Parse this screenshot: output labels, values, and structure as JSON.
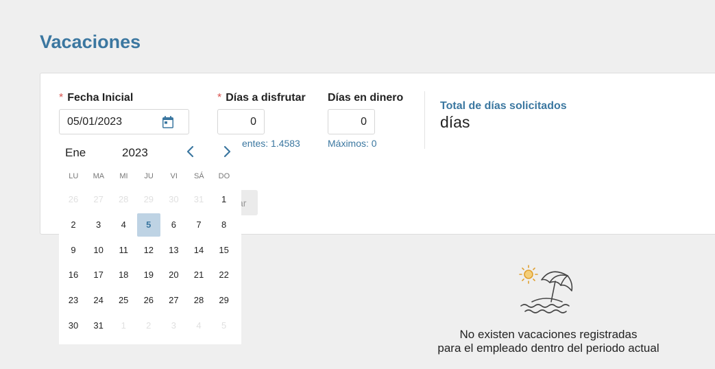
{
  "page": {
    "title": "Vacaciones"
  },
  "form": {
    "fecha_inicial": {
      "required_mark": "*",
      "label": "Fecha Inicial",
      "value": "05/01/2023",
      "icon": "calendar-icon"
    },
    "dias_disfrutar": {
      "required_mark": "*",
      "label": "Días a disfrutar",
      "value": "0",
      "hint": "entes: 1.4583"
    },
    "dias_dinero": {
      "label": "Días en dinero",
      "value": "0",
      "hint": "Máximos: 0"
    },
    "total": {
      "label": "Total de días solicitados",
      "value": "días"
    },
    "partial_button": "ar"
  },
  "calendar": {
    "month": "Ene",
    "year": "2023",
    "weekdays": [
      "LU",
      "MA",
      "MI",
      "JU",
      "VI",
      "SÁ",
      "DO"
    ],
    "weeks": [
      [
        {
          "d": "26",
          "m": true
        },
        {
          "d": "27",
          "m": true
        },
        {
          "d": "28",
          "m": true
        },
        {
          "d": "29",
          "m": true
        },
        {
          "d": "30",
          "m": true
        },
        {
          "d": "31",
          "m": true
        },
        {
          "d": "1"
        }
      ],
      [
        {
          "d": "2"
        },
        {
          "d": "3"
        },
        {
          "d": "4"
        },
        {
          "d": "5",
          "s": true
        },
        {
          "d": "6"
        },
        {
          "d": "7"
        },
        {
          "d": "8"
        }
      ],
      [
        {
          "d": "9"
        },
        {
          "d": "10"
        },
        {
          "d": "11"
        },
        {
          "d": "12"
        },
        {
          "d": "13"
        },
        {
          "d": "14"
        },
        {
          "d": "15"
        }
      ],
      [
        {
          "d": "16"
        },
        {
          "d": "17"
        },
        {
          "d": "18"
        },
        {
          "d": "19"
        },
        {
          "d": "20"
        },
        {
          "d": "21"
        },
        {
          "d": "22"
        }
      ],
      [
        {
          "d": "23"
        },
        {
          "d": "24"
        },
        {
          "d": "25"
        },
        {
          "d": "26"
        },
        {
          "d": "27"
        },
        {
          "d": "28"
        },
        {
          "d": "29"
        }
      ],
      [
        {
          "d": "30"
        },
        {
          "d": "31"
        },
        {
          "d": "1",
          "m": true
        },
        {
          "d": "2",
          "m": true
        },
        {
          "d": "3",
          "m": true
        },
        {
          "d": "4",
          "m": true
        },
        {
          "d": "5",
          "m": true
        }
      ]
    ]
  },
  "empty_state": {
    "icon": "beach-umbrella-icon",
    "line1": "No existen vacaciones registradas",
    "line2": "para el empleado dentro del periodo actual"
  },
  "colors": {
    "accent": "#3b77a0",
    "required": "#d9534f",
    "selected_bg": "#bed3e4"
  }
}
